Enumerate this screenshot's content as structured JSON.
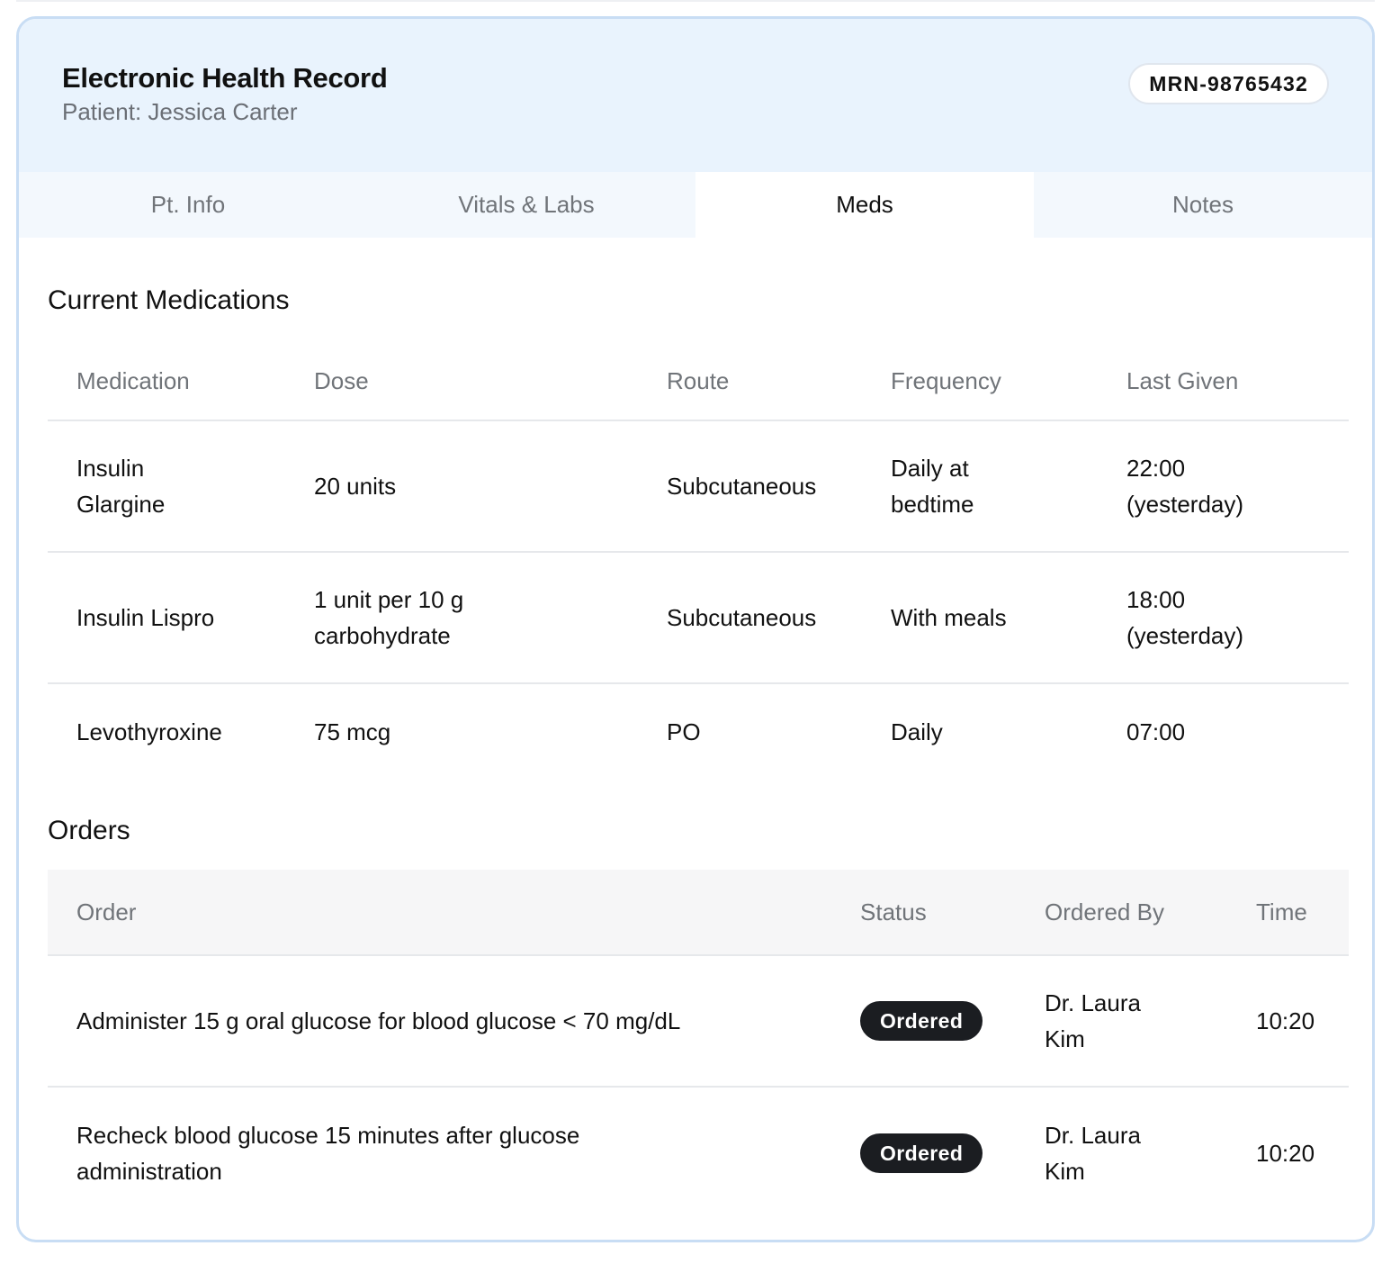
{
  "app": {
    "title": "Electronic Health Record",
    "patient_line": "Patient: Jessica Carter",
    "mrn": "MRN-98765432"
  },
  "tabs": [
    {
      "label": "Pt. Info",
      "active": false
    },
    {
      "label": "Vitals & Labs",
      "active": false
    },
    {
      "label": "Meds",
      "active": true
    },
    {
      "label": "Notes",
      "active": false
    }
  ],
  "medications": {
    "title": "Current Medications",
    "headers": [
      "Medication",
      "Dose",
      "Route",
      "Frequency",
      "Last Given"
    ],
    "rows": [
      [
        "Insulin Glargine",
        "20 units",
        "Subcutaneous",
        "Daily at bedtime",
        "22:00 (yesterday)"
      ],
      [
        "Insulin Lispro",
        "1 unit per 10 g carbohydrate",
        "Subcutaneous",
        "With meals",
        "18:00 (yesterday)"
      ],
      [
        "Levothyroxine",
        "75 mcg",
        "PO",
        "Daily",
        "07:00"
      ]
    ]
  },
  "orders": {
    "title": "Orders",
    "headers": [
      "Order",
      "Status",
      "Ordered By",
      "Time"
    ],
    "rows": [
      [
        "Administer 15 g oral glucose for blood glucose < 70 mg/dL",
        "Ordered",
        "Dr. Laura Kim",
        "10:20"
      ],
      [
        "Recheck blood glucose 15 minutes after glucose administration",
        "Ordered",
        "Dr. Laura Kim",
        "10:20"
      ]
    ]
  },
  "colors": {
    "header_bg": "#e9f3fd",
    "card_border": "#c8ddf4",
    "status_pill": "#1b1d21"
  }
}
